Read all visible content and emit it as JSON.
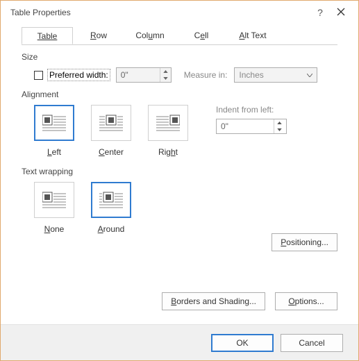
{
  "title": "Table Properties",
  "tabs": {
    "table": "Table",
    "row": "Row",
    "column": "Column",
    "cell": "Cell",
    "alt": "Alt Text"
  },
  "size": {
    "label": "Size",
    "preferred_width_label": "Preferred width:",
    "preferred_width_value": "0\"",
    "measure_in_label": "Measure in:",
    "measure_in_value": "Inches"
  },
  "alignment": {
    "label": "Alignment",
    "left": "Left",
    "center": "Center",
    "right": "Right",
    "indent_label": "Indent from left:",
    "indent_value": "0\""
  },
  "wrap": {
    "label": "Text wrapping",
    "none": "None",
    "around": "Around"
  },
  "buttons": {
    "positioning": "Positioning...",
    "borders": "Borders and Shading...",
    "options": "Options...",
    "ok": "OK",
    "cancel": "Cancel"
  }
}
